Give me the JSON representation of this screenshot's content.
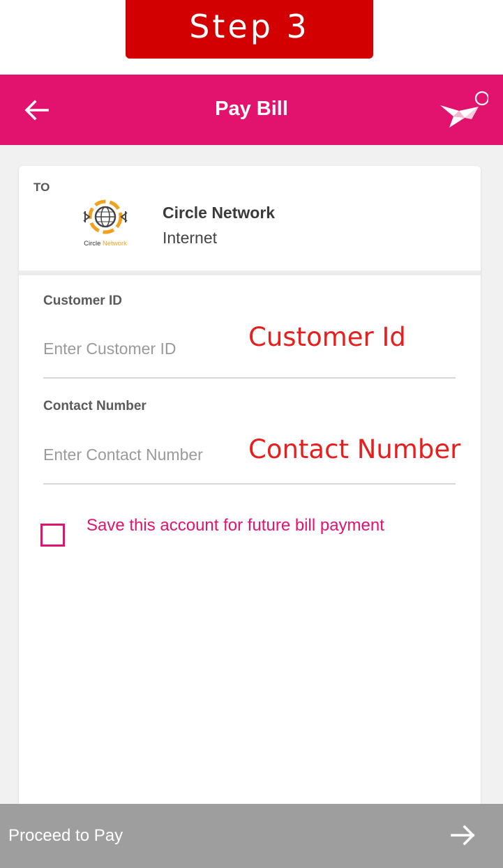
{
  "banner": {
    "step_label": "Step 3"
  },
  "header": {
    "title": "Pay Bill",
    "back_icon": "arrow-left-icon",
    "logo_icon": "bird-logo-icon"
  },
  "recipient": {
    "to_label": "TO",
    "biller_name": "Circle Network",
    "biller_category": "Internet",
    "logo_text_part1": "Circle ",
    "logo_text_part2": "Network"
  },
  "form": {
    "customer_id": {
      "label": "Customer ID",
      "placeholder": "Enter Customer ID",
      "value": ""
    },
    "contact_number": {
      "label": "Contact Number",
      "placeholder": "Enter Contact Number",
      "value": ""
    }
  },
  "annotations": {
    "customer_id": "Customer Id",
    "contact_number": "Contact Number"
  },
  "save_account": {
    "label": "Save this account for future bill payment",
    "checked": false
  },
  "footer": {
    "proceed_label": "Proceed to Pay",
    "arrow_icon": "arrow-right-icon"
  },
  "colors": {
    "brand": "#e2136e",
    "banner": "#d20000",
    "annotation": "#e81d1d",
    "footer": "#9e9e9e"
  }
}
